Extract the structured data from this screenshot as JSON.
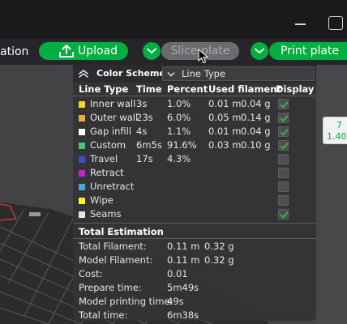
{
  "toolbar": {
    "partial_tab": "ation",
    "upload_label": "Upload",
    "slice_label": "Slice plate",
    "print_label": "Print plate"
  },
  "badge": {
    "line1": "7",
    "line2": "1.40"
  },
  "popup": {
    "title": "Color Scheme",
    "scheme_value": "Line Type",
    "headers": {
      "line_type": "Line Type",
      "time": "Time",
      "percent": "Percent",
      "used_filament": "Used filament",
      "display": "Display"
    },
    "rows": [
      {
        "name": "Inner wall",
        "time": "3s",
        "percent": "1.0%",
        "length": "0.01 m",
        "weight": "0.04 g",
        "color": "#f5d327",
        "display": true
      },
      {
        "name": "Outer wall",
        "time": "23s",
        "percent": "6.0%",
        "length": "0.05 m",
        "weight": "0.14 g",
        "color": "#f2a93b",
        "display": true
      },
      {
        "name": "Gap infill",
        "time": "4s",
        "percent": "1.1%",
        "length": "0.01 m",
        "weight": "0.04 g",
        "color": "#ffffff",
        "display": true
      },
      {
        "name": "Custom",
        "time": "6m5s",
        "percent": "91.6%",
        "length": "0.03 m",
        "weight": "0.10 g",
        "color": "#4fc27a",
        "display": true
      },
      {
        "name": "Travel",
        "time": "17s",
        "percent": "4.3%",
        "length": "",
        "weight": "",
        "color": "#3a4fd6",
        "display": false
      },
      {
        "name": "Retract",
        "time": "",
        "percent": "",
        "length": "",
        "weight": "",
        "color": "#c028c8",
        "display": false
      },
      {
        "name": "Unretract",
        "time": "",
        "percent": "",
        "length": "",
        "weight": "",
        "color": "#40a9d8",
        "display": false
      },
      {
        "name": "Wipe",
        "time": "",
        "percent": "",
        "length": "",
        "weight": "",
        "color": "#f5f528",
        "display": false
      },
      {
        "name": "Seams",
        "time": "",
        "percent": "",
        "length": "",
        "weight": "",
        "color": "#e6e6e6",
        "display": true
      }
    ],
    "total_estimation": {
      "title": "Total Estimation",
      "rows": [
        {
          "label": "Total Filament:",
          "value": "0.11 m",
          "value2": "0.32 g"
        },
        {
          "label": "Model Filament:",
          "value": "0.11 m",
          "value2": "0.32 g"
        },
        {
          "label": "Cost:",
          "value": "0.01",
          "value2": ""
        },
        {
          "label": "Prepare time:",
          "value": "5m49s",
          "value2": ""
        },
        {
          "label": "Model printing time:",
          "value": "49s",
          "value2": ""
        },
        {
          "label": "Total time:",
          "value": "6m38s",
          "value2": ""
        }
      ]
    }
  },
  "colors": {
    "accent": "#00ae42",
    "check": "#2fb350"
  }
}
